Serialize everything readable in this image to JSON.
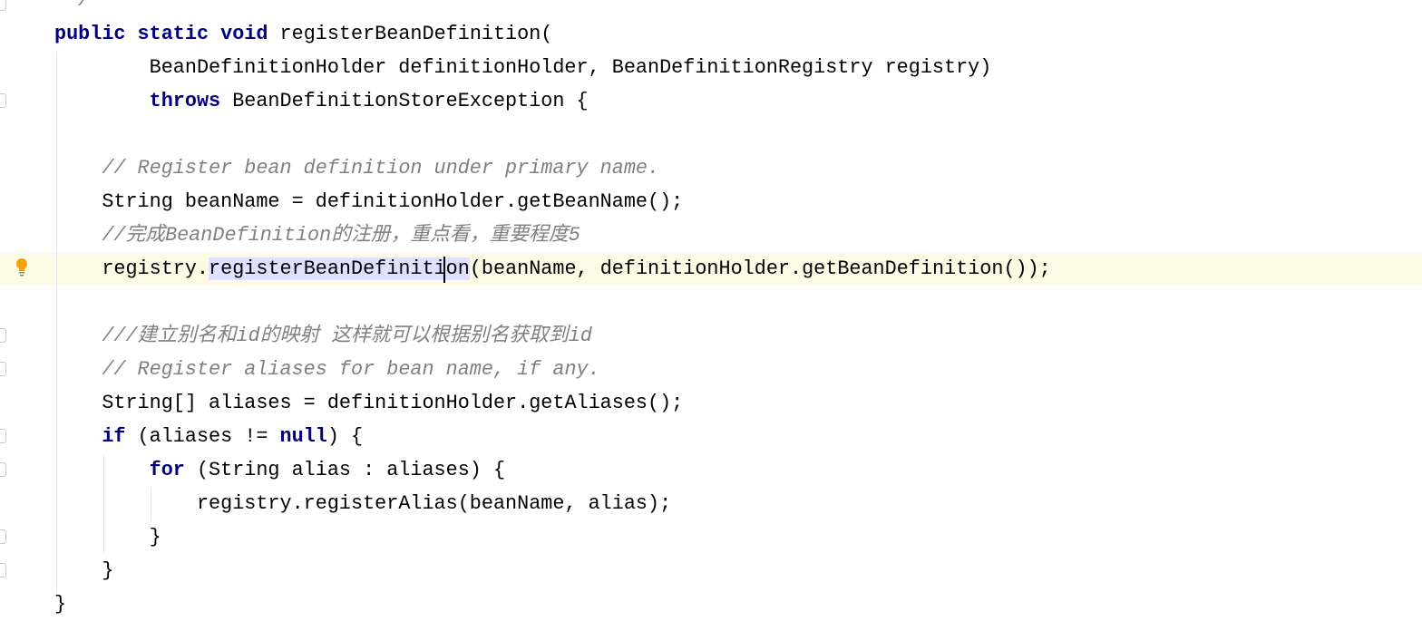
{
  "editor": {
    "language": "Java",
    "colors": {
      "keyword": "#000080",
      "comment": "#808080",
      "current_line": "#fdfae6",
      "selection": "#e0e0ff"
    },
    "gutter_icons": [
      "fold-marker",
      "intention-bulb-icon"
    ],
    "lines": [
      {
        "indent": 0,
        "tokens": [
          {
            "t": " */",
            "c": "cm"
          }
        ]
      },
      {
        "indent": 0,
        "tokens": [
          {
            "t": "public static void",
            "c": "kw"
          },
          {
            "t": " registerBeanDefinition(",
            "c": "pl"
          }
        ]
      },
      {
        "indent": 8,
        "tokens": [
          {
            "t": "BeanDefinitionHolder definitionHolder, BeanDefinitionRegistry registry)",
            "c": "pl"
          }
        ]
      },
      {
        "indent": 8,
        "tokens": [
          {
            "t": "throws",
            "c": "kw"
          },
          {
            "t": " BeanDefinitionStoreException {",
            "c": "pl"
          }
        ]
      },
      {
        "indent": 0,
        "tokens": []
      },
      {
        "indent": 4,
        "tokens": [
          {
            "t": "// Register bean definition under primary name.",
            "c": "cm"
          }
        ]
      },
      {
        "indent": 4,
        "tokens": [
          {
            "t": "String beanName = definitionHolder.getBeanName();",
            "c": "pl"
          }
        ]
      },
      {
        "indent": 4,
        "tokens": [
          {
            "t": "//完成BeanDefinition的注册，重点看，重要程度5",
            "c": "cm"
          }
        ]
      },
      {
        "indent": 4,
        "tokens": [
          {
            "t": "registry.",
            "c": "pl"
          },
          {
            "t": "registerBeanDefinition",
            "c": "pl sel"
          },
          {
            "t": "(beanName, definitionHolder.getBeanDefinition());",
            "c": "pl"
          }
        ]
      },
      {
        "indent": 0,
        "tokens": []
      },
      {
        "indent": 4,
        "tokens": [
          {
            "t": "///建立别名和id的映射 这样就可以根据别名获取到id",
            "c": "cm"
          }
        ]
      },
      {
        "indent": 4,
        "tokens": [
          {
            "t": "// Register aliases for bean name, if any.",
            "c": "cm"
          }
        ]
      },
      {
        "indent": 4,
        "tokens": [
          {
            "t": "String[] aliases = definitionHolder.getAliases();",
            "c": "pl"
          }
        ]
      },
      {
        "indent": 4,
        "tokens": [
          {
            "t": "if",
            "c": "kw"
          },
          {
            "t": " (aliases != ",
            "c": "pl"
          },
          {
            "t": "null",
            "c": "kw"
          },
          {
            "t": ") {",
            "c": "pl"
          }
        ]
      },
      {
        "indent": 8,
        "tokens": [
          {
            "t": "for",
            "c": "kw"
          },
          {
            "t": " (String alias : aliases) {",
            "c": "pl"
          }
        ]
      },
      {
        "indent": 12,
        "tokens": [
          {
            "t": "registry.registerAlias(beanName, alias);",
            "c": "pl"
          }
        ]
      },
      {
        "indent": 8,
        "tokens": [
          {
            "t": "}",
            "c": "pl"
          }
        ]
      },
      {
        "indent": 4,
        "tokens": [
          {
            "t": "}",
            "c": "pl"
          }
        ]
      },
      {
        "indent": 0,
        "tokens": [
          {
            "t": "}",
            "c": "pl"
          }
        ]
      }
    ]
  }
}
